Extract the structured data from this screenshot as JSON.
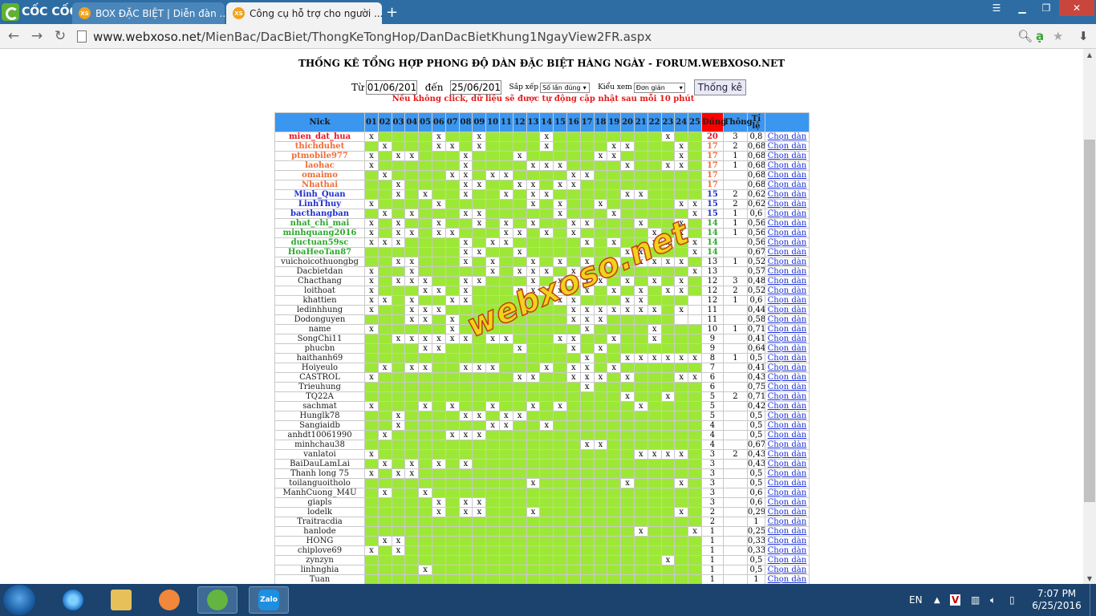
{
  "browser": {
    "brand": "CỐC CỐC",
    "tabs": [
      {
        "label": "BOX ĐẶC BIỆT | Diễn đàn ...",
        "favicon": "xs-favicon",
        "active": false
      },
      {
        "label": "Công cụ hỗ trợ cho người ...",
        "favicon": "xs-favicon",
        "active": true
      }
    ],
    "url_host": "www.webxoso.net",
    "url_path": "/MienBac/DacBiet/ThongKeTongHop/DanDacBietKhung1NgayView2FR.aspx"
  },
  "page": {
    "title": "THỐNG KÊ TỔNG HỢP PHONG ĐỘ DÀN ĐẶC BIỆT HÀNG NGÀY - FORUM.WEBXOSO.NET",
    "from_label": "Từ",
    "from_value": "01/06/2016",
    "to_label": "đến",
    "to_value": "25/06/2016",
    "sort_label": "Sắp xếp",
    "sort_value": "Số lần đúng",
    "view_label": "Kiểu xem",
    "view_value": "Đơn giản",
    "submit_label": "Thống kê",
    "notice": "Nếu không click, dữ liệu sẽ được tự động cập nhật sau mỗi 10 phút",
    "watermark": "webxoso.net"
  },
  "table": {
    "headers": {
      "nick": "Nick",
      "days": [
        "01",
        "02",
        "03",
        "04",
        "05",
        "06",
        "07",
        "08",
        "09",
        "10",
        "11",
        "12",
        "13",
        "14",
        "15",
        "16",
        "17",
        "18",
        "19",
        "20",
        "21",
        "22",
        "23",
        "24",
        "25"
      ],
      "correct": "Đúng",
      "streak": "Thông",
      "ratio_line1": "Tỉ",
      "ratio_line2": "lệ",
      "action": ""
    },
    "action_label": "Chọn dàn",
    "rows": [
      {
        "nick": "mien_dat_hua",
        "color": "#e8141e",
        "cells": "x1111x11x1111x11111111x1111",
        "correct": "20",
        "streak": "3",
        "ratio": "0,8"
      },
      {
        "nick": "thichduhet",
        "color": "#f26b35",
        "cells": "1x111xx1x1111x1111xx111x11",
        "correct": "17",
        "streak": "2",
        "ratio": "0,68"
      },
      {
        "nick": "ptmobile977",
        "color": "#f26b35",
        "cells": "x1xx111x111x11111xx1111x11",
        "correct": "17",
        "streak": "1",
        "ratio": "0,68"
      },
      {
        "nick": "laohac",
        "color": "#f26b35",
        "cells": "x111111x1111xxx1111x11xx11",
        "correct": "17",
        "streak": "1",
        "ratio": "0,68"
      },
      {
        "nick": "omaimo",
        "color": "#f26b35",
        "cells": "1x1111xx1xx1111xx11111111x",
        "correct": "17",
        "streak": "",
        "ratio": "0,68"
      },
      {
        "nick": "Nhathai",
        "color": "#f26b35",
        "cells": "11x1111xx11xx1xx1111111111x",
        "correct": "17",
        "streak": "",
        "ratio": "0,68"
      },
      {
        "nick": "Minh_Quan",
        "color": "#1f2fd0",
        "cells": "11x1x11x11x1xx11111xx111111x",
        "correct": "15",
        "streak": "2",
        "ratio": "0,62"
      },
      {
        "nick": "LinhThuy",
        "color": "#1f2fd0",
        "cells": "x1111x111111x1x11x11111xx11",
        "correct": "15",
        "streak": "2",
        "ratio": "0,62"
      },
      {
        "nick": "bacthangban",
        "color": "#1f2fd0",
        "cells": "1x1x111xx11111x111x11111xx1",
        "correct": "15",
        "streak": "1",
        "ratio": "0,6"
      },
      {
        "nick": "nhat_chi_mai",
        "color": "#2aa82a",
        "cells": "x1x11x11x1x1x11xx111x11x1",
        "correct": "14",
        "streak": "1",
        "ratio": "0,56"
      },
      {
        "nick": "minhquang2016",
        "color": "#2aa82a",
        "cells": "x1xx1xx111xx1x1x11111x1x1",
        "correct": "14",
        "streak": "1",
        "ratio": "0,56"
      },
      {
        "nick": "ductuan59sc",
        "color": "#2aa82a",
        "cells": "xxx1111x1xx11111x1x11xx1x",
        "correct": "14",
        "streak": "",
        "ratio": "0,56"
      },
      {
        "nick": "HoaHeoTan87",
        "color": "#2aa82a",
        "cells": "1111111xx11x1111111xx111x1x",
        "correct": "14",
        "streak": "",
        "ratio": "0,67"
      },
      {
        "nick": "vuichoicothuongbg",
        "color": "#1a1a1a",
        "cells": "11xx111x1x11x1x1x1x1xxxx11",
        "correct": "13",
        "streak": "1",
        "ratio": "0,52"
      },
      {
        "nick": "Dacbietdan",
        "color": "#1a1a1a",
        "cells": "x11x11111x1xxx1x11111111xxx",
        "correct": "13",
        "streak": "",
        "ratio": "0,57"
      },
      {
        "nick": "Chacthang",
        "color": "#1a1a1a",
        "cells": "x1xxx11xx111x1xxxx1x1x1x1",
        "correct": "12",
        "streak": "3",
        "ratio": "0,48"
      },
      {
        "nick": "loithoat",
        "color": "#1a1a1a",
        "cells": "x111xx1x111xxxx1x1x1x1xx1",
        "correct": "12",
        "streak": "2",
        "ratio": "0,52"
      },
      {
        "nick": "khattien",
        "color": "#1a1a1a",
        "cells": "xx1x11xx111111xx111xx111",
        "correct": "12",
        "streak": "1",
        "ratio": "0,6"
      },
      {
        "nick": "ledinhhung",
        "color": "#1a1a1a",
        "cells": "x11xxx111111111xxxxxxx1x",
        "correct": "11",
        "streak": "",
        "ratio": "0,44"
      },
      {
        "nick": "Dodonguyen",
        "color": "#1a1a1a",
        "cells": "111xx1x11111111xxx11111",
        "correct": "11",
        "streak": "",
        "ratio": "0,58"
      },
      {
        "nick": "name",
        "color": "#1a1a1a",
        "cells": "x11111x111111111x1111x111",
        "correct": "10",
        "streak": "1",
        "ratio": "0,71"
      },
      {
        "nick": "SongChi11",
        "color": "#1a1a1a",
        "cells": "11xxxxxx1xx111xx11x11x111xx",
        "correct": "9",
        "streak": "",
        "ratio": "0,41"
      },
      {
        "nick": "phucbn",
        "color": "#1a1a1a",
        "cells": "1111xx11111x111x1x11111111",
        "correct": "9",
        "streak": "",
        "ratio": "0,64"
      },
      {
        "nick": "haithanh69",
        "color": "#1a1a1a",
        "cells": "1111111111111111x11xxxxxxx1",
        "correct": "8",
        "streak": "1",
        "ratio": "0,5"
      },
      {
        "nick": "Hoiyeulo",
        "color": "#1a1a1a",
        "cells": "1x1xx11xxx111x1xx1x111111",
        "correct": "7",
        "streak": "",
        "ratio": "0,41"
      },
      {
        "nick": "CASTROL",
        "color": "#1a1a1a",
        "cells": "x1111111111xx11xxx1x111xx",
        "correct": "6",
        "streak": "",
        "ratio": "0,43"
      },
      {
        "nick": "Trieuhung",
        "color": "#1a1a1a",
        "cells": "1111111111111111x11111111x",
        "correct": "6",
        "streak": "",
        "ratio": "0,75"
      },
      {
        "nick": "TQ22A",
        "color": "#1a1a1a",
        "cells": "1111111111111111111x11x1111",
        "correct": "5",
        "streak": "2",
        "ratio": "0,71"
      },
      {
        "nick": "sachmat",
        "color": "#1a1a1a",
        "cells": "x111x1x11x11x1x11111x11111",
        "correct": "5",
        "streak": "",
        "ratio": "0,42"
      },
      {
        "nick": "Hunglk78",
        "color": "#1a1a1a",
        "cells": "11x1111xx1xx11111111111111",
        "correct": "5",
        "streak": "",
        "ratio": "0,5"
      },
      {
        "nick": "Sangiaidb",
        "color": "#1a1a1a",
        "cells": "11x111111xx11x111111111111",
        "correct": "4",
        "streak": "",
        "ratio": "0,5"
      },
      {
        "nick": "anhdt10061990",
        "color": "#1a1a1a",
        "cells": "1x1111xxx11111111111111111",
        "correct": "4",
        "streak": "",
        "ratio": "0,5"
      },
      {
        "nick": "minhchau38",
        "color": "#1a1a1a",
        "cells": "1111111111111111xx11111111",
        "correct": "4",
        "streak": "",
        "ratio": "0,67"
      },
      {
        "nick": "vanlatoi",
        "color": "#1a1a1a",
        "cells": "x1111111111111111111xxxx11",
        "correct": "3",
        "streak": "2",
        "ratio": "0,43"
      },
      {
        "nick": "BaiDauLamLai",
        "color": "#1a1a1a",
        "cells": "1x1x1x1x11111111111111111",
        "correct": "3",
        "streak": "",
        "ratio": "0,43"
      },
      {
        "nick": "Thanh long 75",
        "color": "#1a1a1a",
        "cells": "x1xx11111111111111111111111",
        "correct": "3",
        "streak": "",
        "ratio": "0,5"
      },
      {
        "nick": "toilanguoitholo",
        "color": "#1a1a1a",
        "cells": "111111111111x111111x111x11",
        "correct": "3",
        "streak": "",
        "ratio": "0,5"
      },
      {
        "nick": "ManhCuong_M4U",
        "color": "#1a1a1a",
        "cells": "1x11x11111111111111111111",
        "correct": "3",
        "streak": "",
        "ratio": "0,6"
      },
      {
        "nick": "giapls",
        "color": "#1a1a1a",
        "cells": "11111x1xx1111111111111111",
        "correct": "3",
        "streak": "",
        "ratio": "0,6"
      },
      {
        "nick": "lodelk",
        "color": "#1a1a1a",
        "cells": "11111x1xx111x1111111111x11",
        "correct": "2",
        "streak": "",
        "ratio": "0,29"
      },
      {
        "nick": "Traitracdia",
        "color": "#1a1a1a",
        "cells": "1111111111111111111111111",
        "correct": "2",
        "streak": "",
        "ratio": "1"
      },
      {
        "nick": "hanlode",
        "color": "#1a1a1a",
        "cells": "11111111111111111111x111xx",
        "correct": "1",
        "streak": "",
        "ratio": "0,25"
      },
      {
        "nick": "HONG",
        "color": "#1a1a1a",
        "cells": "1xx1111111111111111111111",
        "correct": "1",
        "streak": "",
        "ratio": "0,33"
      },
      {
        "nick": "chiplove69",
        "color": "#1a1a1a",
        "cells": "x1x11111111111111111111111",
        "correct": "1",
        "streak": "",
        "ratio": "0,33"
      },
      {
        "nick": "zynzyn",
        "color": "#1a1a1a",
        "cells": "1111111111111111111111x11",
        "correct": "1",
        "streak": "",
        "ratio": "0,5"
      },
      {
        "nick": "linhnghia",
        "color": "#1a1a1a",
        "cells": "1111x11111111111111111111",
        "correct": "1",
        "streak": "",
        "ratio": "0,5"
      },
      {
        "nick": "Tuan",
        "color": "#1a1a1a",
        "cells": "1111111111111111111111111",
        "correct": "1",
        "streak": "",
        "ratio": "1"
      }
    ]
  },
  "taskbar": {
    "lang": "EN",
    "time": "7:07 PM",
    "date": "6/25/2016",
    "apps": [
      "ie-icon",
      "explorer-icon",
      "media-player-icon",
      "coccoc-icon",
      "zalo-icon"
    ],
    "zalo_label": "Zalo"
  },
  "colors": {
    "green_cell": "#9de837",
    "header_blue": "#3b96f0",
    "correct_red": "#ff0000",
    "link_blue": "#1a2fd6"
  }
}
